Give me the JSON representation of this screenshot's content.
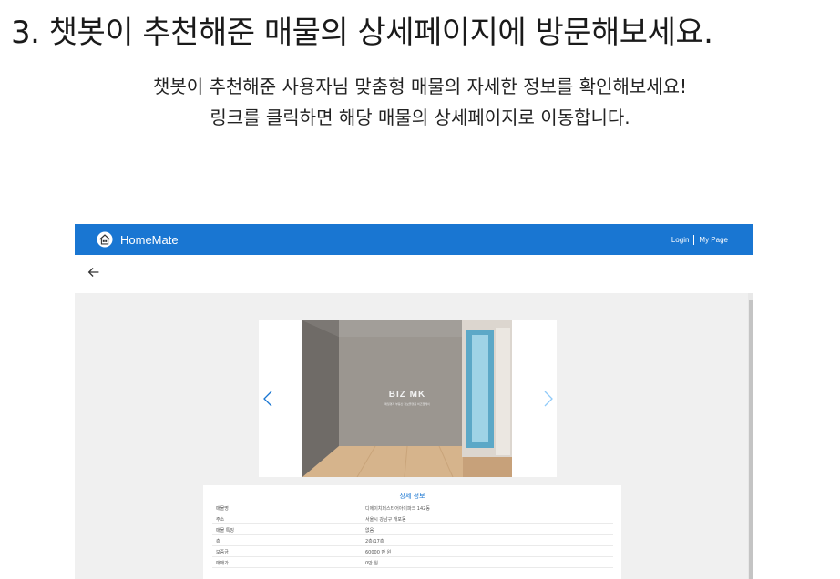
{
  "slide": {
    "heading": "3. 챗봇이 추천해준 매물의 상세페이지에 방문해보세요.",
    "desc_line1": "챗봇이 추천해준 사용자님 맞춤형 매물의 자세한 정보를 확인해보세요!",
    "desc_line2": "링크를 클릭하면 해당 매물의 상세페이지로 이동합니다."
  },
  "app": {
    "brand": "HomeMate",
    "login": "Login",
    "mypage": "My Page",
    "accent": "#1976d2"
  },
  "gallery": {
    "watermark_title": "BIZ MK",
    "watermark_sub": "매일경제 부동산 정보플랫폼 비즈엠케이"
  },
  "detail": {
    "title": "상세 정보",
    "rows": [
      {
        "label": "매물명",
        "value": "디에이치퍼스티어아이파크 142동"
      },
      {
        "label": "주소",
        "value": "서울시 강남구 개포동"
      },
      {
        "label": "매물 특징",
        "value": "없음"
      },
      {
        "label": "층",
        "value": "2층/17층"
      },
      {
        "label": "보증금",
        "value": "60000 만 원"
      },
      {
        "label": "매매가",
        "value": "0만 원"
      }
    ]
  },
  "icons": [
    "home-icon",
    "back-arrow-icon",
    "chevron-left-icon",
    "chevron-right-icon"
  ]
}
